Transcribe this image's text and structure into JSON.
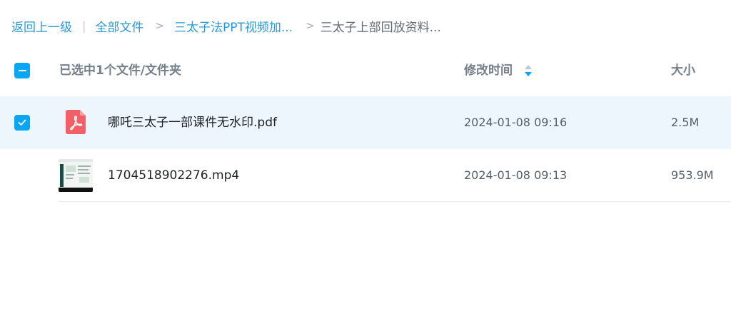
{
  "breadcrumb": {
    "back_label": "返回上一级",
    "root_label": "全部文件",
    "folder_label": "三太子法PPT视频加...",
    "current_label": "三太子上部回放资料..."
  },
  "header": {
    "selection_label": "已选中1个文件/文件夹",
    "modified_label": "修改时间",
    "size_label": "大小"
  },
  "files": [
    {
      "name": "哪吒三太子一部课件无水印.pdf",
      "modified": "2024-01-08 09:16",
      "size": "2.5M",
      "selected": true,
      "type": "pdf"
    },
    {
      "name": "1704518902276.mp4",
      "modified": "2024-01-08 09:13",
      "size": "953.9M",
      "selected": false,
      "type": "video"
    }
  ],
  "colors": {
    "accent": "#08a6f5",
    "link": "#2a9ad8",
    "selected_row": "#eef6fd",
    "pdf_red": "#f35f66"
  }
}
